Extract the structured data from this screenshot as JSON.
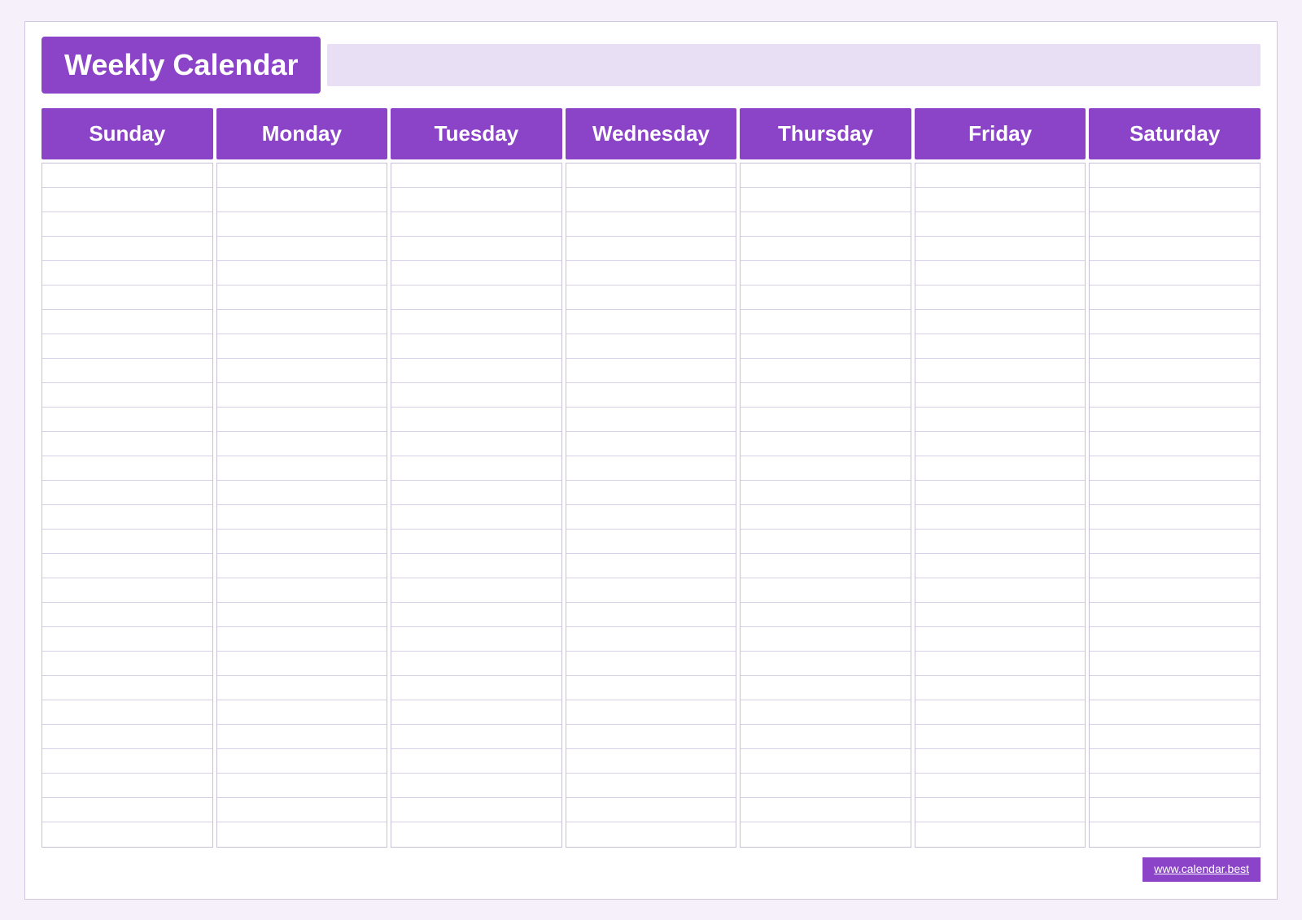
{
  "header": {
    "title": "Weekly Calendar",
    "accent_color": "#8b44c8",
    "accent_light": "#e8dff5"
  },
  "days": [
    {
      "label": "Sunday"
    },
    {
      "label": "Monday"
    },
    {
      "label": "Tuesday"
    },
    {
      "label": "Wednesday"
    },
    {
      "label": "Thursday"
    },
    {
      "label": "Friday"
    },
    {
      "label": "Saturday"
    }
  ],
  "footer": {
    "link_text": "www.calendar.best",
    "link_url": "https://www.calendar.best"
  },
  "lines_per_column": 28
}
